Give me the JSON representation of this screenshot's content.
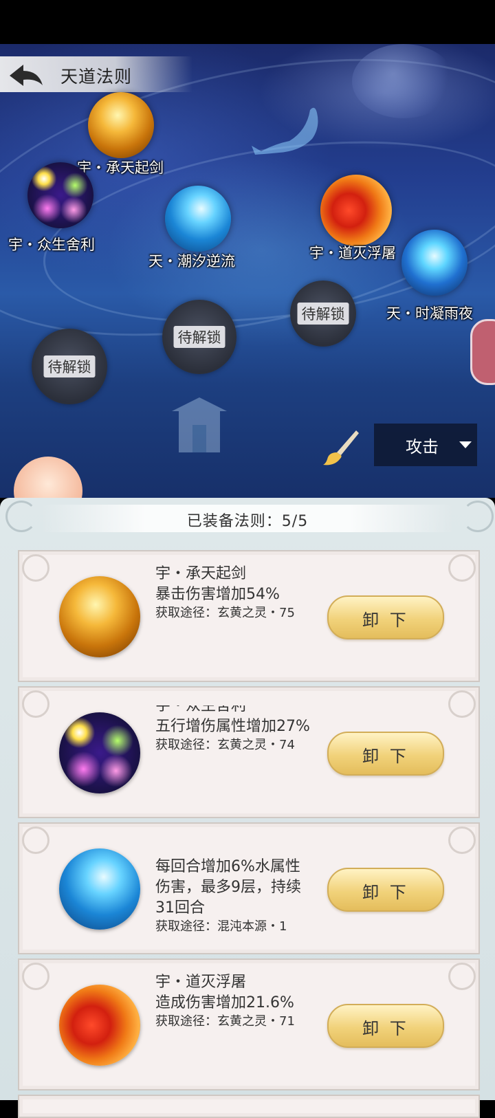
{
  "header": {
    "title": "天道法则",
    "back_icon": "back-arrow-icon"
  },
  "map_nodes": [
    {
      "label": "宇・承天起剑",
      "style": "gold"
    },
    {
      "label": "宇・众生舍利",
      "style": "spirit"
    },
    {
      "label": "天・潮汐逆流",
      "style": "tide"
    },
    {
      "label": "宇・道灭浮屠",
      "style": "fire"
    },
    {
      "label": "天・时凝雨夜",
      "style": "rain"
    }
  ],
  "locked_nodes": [
    {
      "label": "待解锁"
    },
    {
      "label": "待解锁"
    },
    {
      "label": "待解锁"
    }
  ],
  "controls": {
    "brush_icon": "brush-icon",
    "filter_selected": "攻击",
    "filter_icon": "caret-down-icon"
  },
  "panel": {
    "title": "已装备法则：5/5"
  },
  "equipped": [
    {
      "name": "宇・承天起剑",
      "effect": "暴击伤害增加54%",
      "source": "获取途径：玄黄之灵・75",
      "button": "卸 下",
      "style": "gold"
    },
    {
      "name": "宇・众生舍利",
      "effect": "五行增伤属性增加27%",
      "source": "获取途径：玄黄之灵・74",
      "button": "卸 下",
      "style": "spirit"
    },
    {
      "name": "",
      "effect": "每回合增加6%水属性伤害，最多9层，持续31回合",
      "source": "获取途径：混沌本源・1",
      "button": "卸 下",
      "style": "tide"
    },
    {
      "name": "宇・道灭浮屠",
      "effect": "造成伤害增加21.6%",
      "source": "获取途径：玄黄之灵・71",
      "button": "卸 下",
      "style": "fire"
    }
  ],
  "colors": {
    "button_gold": "#f1d27a",
    "card_bg": "#f6f0ef",
    "panel_bg": "#dfe8ea",
    "map_bg": "#233e8f"
  }
}
